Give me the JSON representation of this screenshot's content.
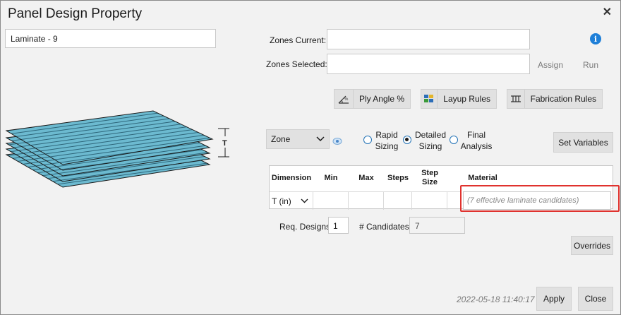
{
  "window": {
    "title": "Panel Design Property"
  },
  "left": {
    "name_field": "Laminate - 9",
    "thickness_label": "T"
  },
  "zones": {
    "current_label": "Zones Current:",
    "current_value": "",
    "selected_label": "Zones Selected:",
    "selected_value": "",
    "assign_label": "Assign",
    "run_label": "Run"
  },
  "toolbar": {
    "ply_angle_label": "Ply Angle %",
    "layup_rules_label": "Layup Rules",
    "fabrication_rules_label": "Fabrication Rules"
  },
  "scope": {
    "select_value": "Zone",
    "options": [
      {
        "label_line1": "Rapid",
        "label_line2": "Sizing",
        "selected": false
      },
      {
        "label_line1": "Detailed",
        "label_line2": "Sizing",
        "selected": true
      },
      {
        "label_line1": "Final",
        "label_line2": "Analysis",
        "selected": false
      }
    ],
    "set_variables_label": "Set Variables"
  },
  "table": {
    "headers": {
      "dimension": "Dimension",
      "min": "Min",
      "max": "Max",
      "steps": "Steps",
      "step_size_1": "Step",
      "step_size_2": "Size",
      "material": "Material"
    },
    "row": {
      "dimension": "T (in)",
      "min": "",
      "max": "",
      "steps": "",
      "step_size": "",
      "material_placeholder": "(7 effective laminate candidates)"
    }
  },
  "bottom": {
    "req_designs_label": "Req. Designs",
    "req_designs_value": "1",
    "candidates_label": "# Candidates",
    "candidates_value": "7",
    "overrides_label": "Overrides",
    "timestamp": "2022-05-18 11:40:17",
    "apply_label": "Apply",
    "close_label": "Close"
  },
  "colors": {
    "accent": "#1e7fd8",
    "highlight": "#e0322e",
    "ply_fill": "#5fb3c8"
  }
}
